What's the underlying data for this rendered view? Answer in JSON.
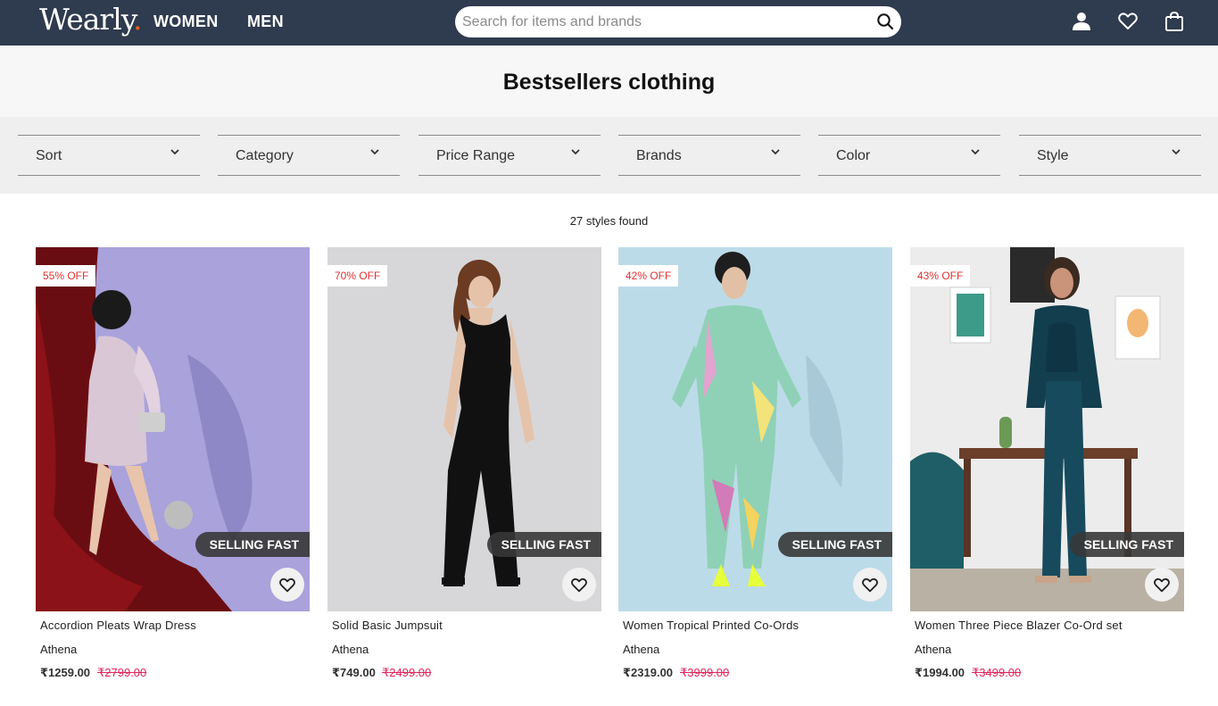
{
  "header": {
    "logo_text": "Wearly",
    "logo_dot": ".",
    "nav": [
      "WOMEN",
      "MEN"
    ],
    "search_placeholder": "Search for items and brands",
    "icons": [
      "user-icon",
      "heart-icon",
      "bag-icon"
    ]
  },
  "page": {
    "title": "Bestsellers clothing",
    "count_text": "27 styles found"
  },
  "filters": [
    "Sort",
    "Category",
    "Price Range",
    "Brands",
    "Color",
    "Style"
  ],
  "products": [
    {
      "discount": "55% OFF",
      "tag": "SELLING FAST",
      "name": "Accordion Pleats Wrap Dress",
      "brand": "Athena",
      "price": "₹1259.00",
      "mrp": "₹2799.00"
    },
    {
      "discount": "70% OFF",
      "tag": "SELLING FAST",
      "name": "Solid Basic Jumpsuit",
      "brand": "Athena",
      "price": "₹749.00",
      "mrp": "₹2499.00"
    },
    {
      "discount": "42% OFF",
      "tag": "SELLING FAST",
      "name": "Women Tropical Printed Co-Ords",
      "brand": "Athena",
      "price": "₹2319.00",
      "mrp": "₹3999.00"
    },
    {
      "discount": "43% OFF",
      "tag": "SELLING FAST",
      "name": "Women Three Piece Blazer Co-Ord set",
      "brand": "Athena",
      "price": "₹1994.00",
      "mrp": "₹3499.00"
    }
  ],
  "colors": {
    "header_bg": "#2f3b4e",
    "logo_accent": "#e8601c",
    "discount_text": "#e03131",
    "mrp_text": "#e0265e"
  }
}
